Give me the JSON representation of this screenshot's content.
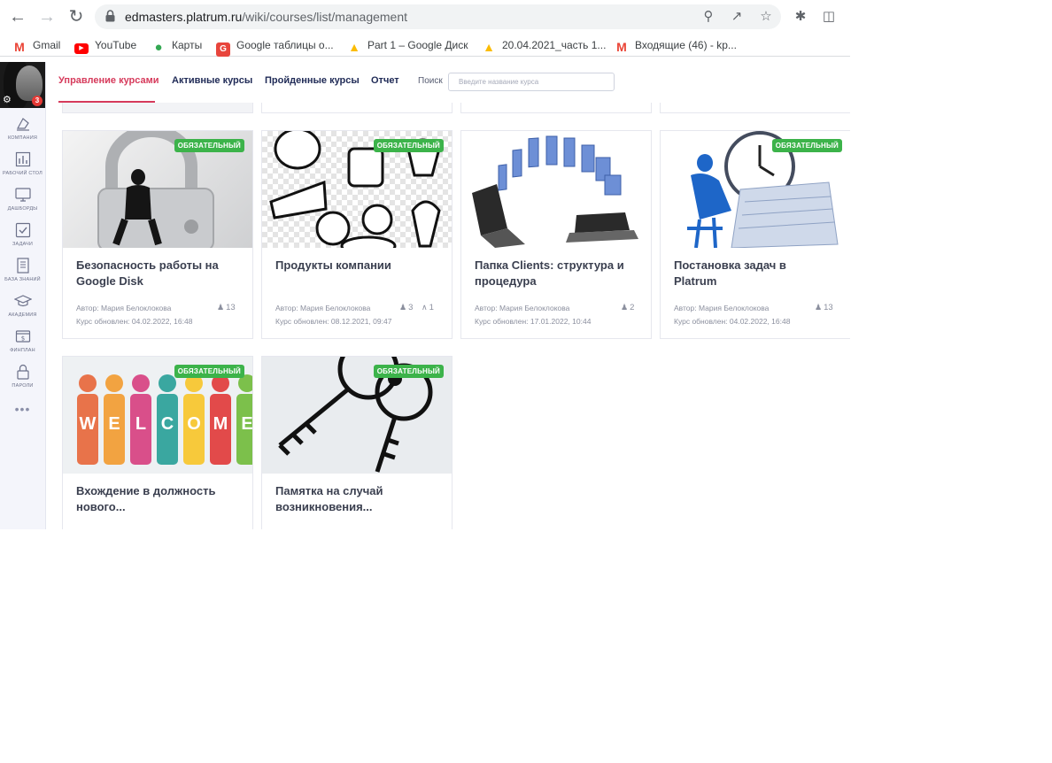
{
  "browser": {
    "url_host": "edmasters.platrum.ru",
    "url_path": "/wiki/courses/list/management",
    "bookmarks": [
      {
        "label": "Gmail",
        "icon": "gmail-icon",
        "color": "#ea4335"
      },
      {
        "label": "YouTube",
        "icon": "youtube-icon",
        "color": "#ff0000"
      },
      {
        "label": "Карты",
        "icon": "maps-icon",
        "color": "#34a853"
      },
      {
        "label": "Google таблицы о...",
        "icon": "sheets-icon",
        "color": "#e8453c"
      },
      {
        "label": "Part 1 – Google Диск",
        "icon": "drive-icon",
        "color": "#fbbc04"
      },
      {
        "label": "20.04.2021_часть 1...",
        "icon": "drive-icon",
        "color": "#fbbc04"
      },
      {
        "label": "Входящие (46) - kp...",
        "icon": "gmail-icon",
        "color": "#ea4335"
      }
    ]
  },
  "sidebar": {
    "avatar_badge": "3",
    "items": [
      {
        "label": "КОМПАНИЯ",
        "icon": "company-icon"
      },
      {
        "label": "РАБОЧИЙ СТОЛ",
        "icon": "desktop-chart-icon"
      },
      {
        "label": "ДАШБОРДЫ",
        "icon": "monitor-icon"
      },
      {
        "label": "ЗАДАЧИ",
        "icon": "checkbox-icon"
      },
      {
        "label": "БАЗА ЗНАНИЙ",
        "icon": "document-icon"
      },
      {
        "label": "АКАДЕМИЯ",
        "icon": "graduation-cap-icon"
      },
      {
        "label": "ФИНПЛАН",
        "icon": "finance-icon"
      },
      {
        "label": "ПАРОЛИ",
        "icon": "lock-icon"
      }
    ],
    "more": "•••"
  },
  "tabs": [
    {
      "label": "Управление курсами",
      "active": true
    },
    {
      "label": "Активные курсы",
      "active": false
    },
    {
      "label": "Пройденные курсы",
      "active": false
    },
    {
      "label": "Отчет",
      "active": false
    }
  ],
  "search": {
    "label": "Поиск",
    "placeholder": "Введите название курса",
    "value": ""
  },
  "courses": [
    {
      "title": "Безопасность работы на Google Disk",
      "badge": "ОБЯЗАТЕЛЬНЫЙ",
      "author": "Автор: Мария Белоклокова",
      "updated": "Курс обновлен: 04.02.2022, 16:48",
      "users": "13",
      "passed": ""
    },
    {
      "title": "Продукты компании",
      "badge": "ОБЯЗАТЕЛЬНЫЙ",
      "author": "Автор: Мария Белоклокова",
      "updated": "Курс обновлен: 08.12.2021, 09:47",
      "users": "3",
      "passed": "1"
    },
    {
      "title": "Папка Clients: структура и процедура",
      "badge": "",
      "author": "Автор: Мария Белоклокова",
      "updated": "Курс обновлен: 17.01.2022, 10:44",
      "users": "2",
      "passed": ""
    },
    {
      "title": "Постановка задач в Platrum",
      "badge": "ОБЯЗАТЕЛЬНЫЙ",
      "author": "Автор: Мария Белоклокова",
      "updated": "Курс обновлен: 04.02.2022, 16:48",
      "users": "13",
      "passed": ""
    },
    {
      "title": "Вхождение в должность нового...",
      "badge": "ОБЯЗАТЕЛЬНЫЙ",
      "author": "",
      "updated": "",
      "users": "",
      "passed": ""
    },
    {
      "title": "Памятка на случай возникновения...",
      "badge": "ОБЯЗАТЕЛЬНЫЙ",
      "author": "",
      "updated": "",
      "users": "",
      "passed": ""
    }
  ],
  "welcome_letters": [
    "W",
    "E",
    "L",
    "C",
    "O",
    "M",
    "E"
  ],
  "colors": {
    "accent": "#d63a5b",
    "nav_text": "#1f2a56",
    "badge_green": "#3cb34a",
    "notify_red": "#e53935"
  }
}
